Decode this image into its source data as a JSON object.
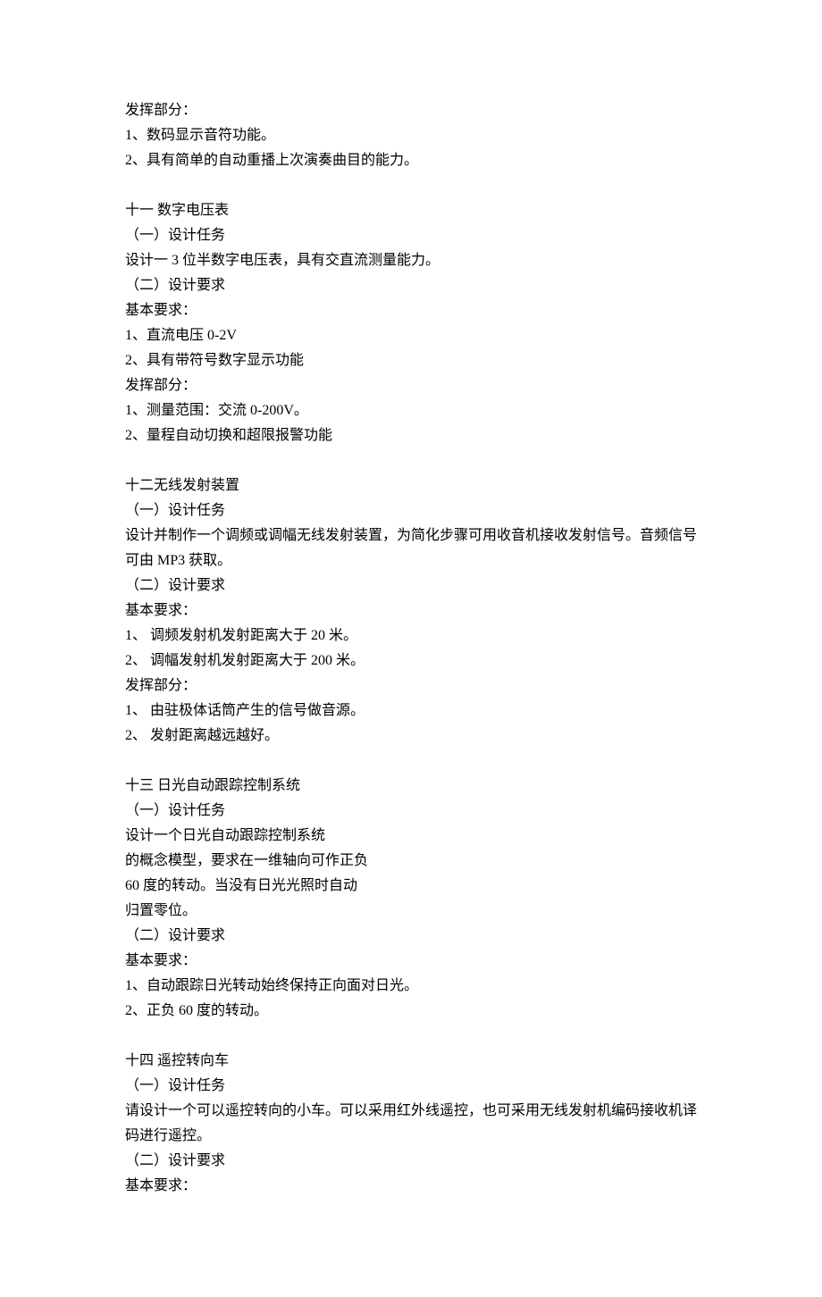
{
  "lines": [
    "发挥部分：",
    "1、数码显示音符功能。",
    "2、具有简单的自动重播上次演奏曲目的能力。",
    "",
    "十一 数字电压表",
    "（一）设计任务",
    "设计一 3 位半数字电压表，具有交直流测量能力。",
    "（二）设计要求",
    "基本要求：",
    "1、直流电压 0-2V",
    "2、具有带符号数字显示功能",
    "发挥部分：",
    "1、测量范围：交流 0-200V。",
    "2、量程自动切换和超限报警功能",
    "",
    "十二无线发射装置",
    "（一）设计任务",
    "设计并制作一个调频或调幅无线发射装置，为简化步骤可用收音机接收发射信号。音频信号可由 MP3 获取。",
    "（二）设计要求",
    "基本要求：",
    "1、 调频发射机发射距离大于 20 米。",
    "2、 调幅发射机发射距离大于 200 米。",
    "发挥部分：",
    "1、 由驻极体话筒产生的信号做音源。",
    "2、 发射距离越远越好。",
    "",
    "十三 日光自动跟踪控制系统",
    "（一）设计任务",
    "设计一个日光自动跟踪控制系统",
    "的概念模型，要求在一维轴向可作正负",
    "60 度的转动。当没有日光光照时自动",
    "归置零位。",
    "（二）设计要求",
    "基本要求：",
    "1、自动跟踪日光转动始终保持正向面对日光。",
    "2、正负 60 度的转动。",
    "",
    "十四 遥控转向车",
    "（一）设计任务",
    "请设计一个可以遥控转向的小车。可以采用红外线遥控，也可采用无线发射机编码接收机译码进行遥控。",
    "（二）设计要求",
    "基本要求："
  ]
}
